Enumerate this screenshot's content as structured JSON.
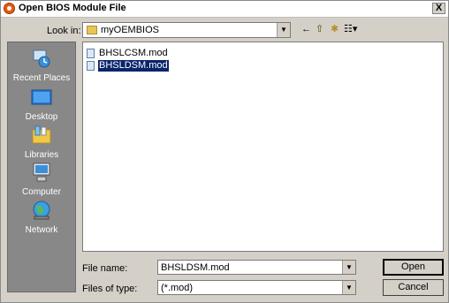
{
  "window": {
    "title": "Open BIOS Module File",
    "close_glyph": "X"
  },
  "lookin": {
    "label": "Look in:",
    "value": "myOEMBIOS",
    "toolbar": {
      "back": "←",
      "up": "⇧",
      "newfolder": "✱",
      "view": "☷▾"
    }
  },
  "places": [
    {
      "label": "Recent Places",
      "icon": "recent-places-icon"
    },
    {
      "label": "Desktop",
      "icon": "desktop-icon"
    },
    {
      "label": "Libraries",
      "icon": "libraries-icon"
    },
    {
      "label": "Computer",
      "icon": "computer-icon"
    },
    {
      "label": "Network",
      "icon": "network-icon"
    }
  ],
  "files": [
    {
      "name": "BHSLCSM.mod",
      "selected": false
    },
    {
      "name": "BHSLDSM.mod",
      "selected": true
    }
  ],
  "filename": {
    "label": "File name:",
    "value": "BHSLDSM.mod"
  },
  "filetype": {
    "label": "Files of type:",
    "value": "(*.mod)"
  },
  "buttons": {
    "open": "Open",
    "cancel": "Cancel"
  }
}
